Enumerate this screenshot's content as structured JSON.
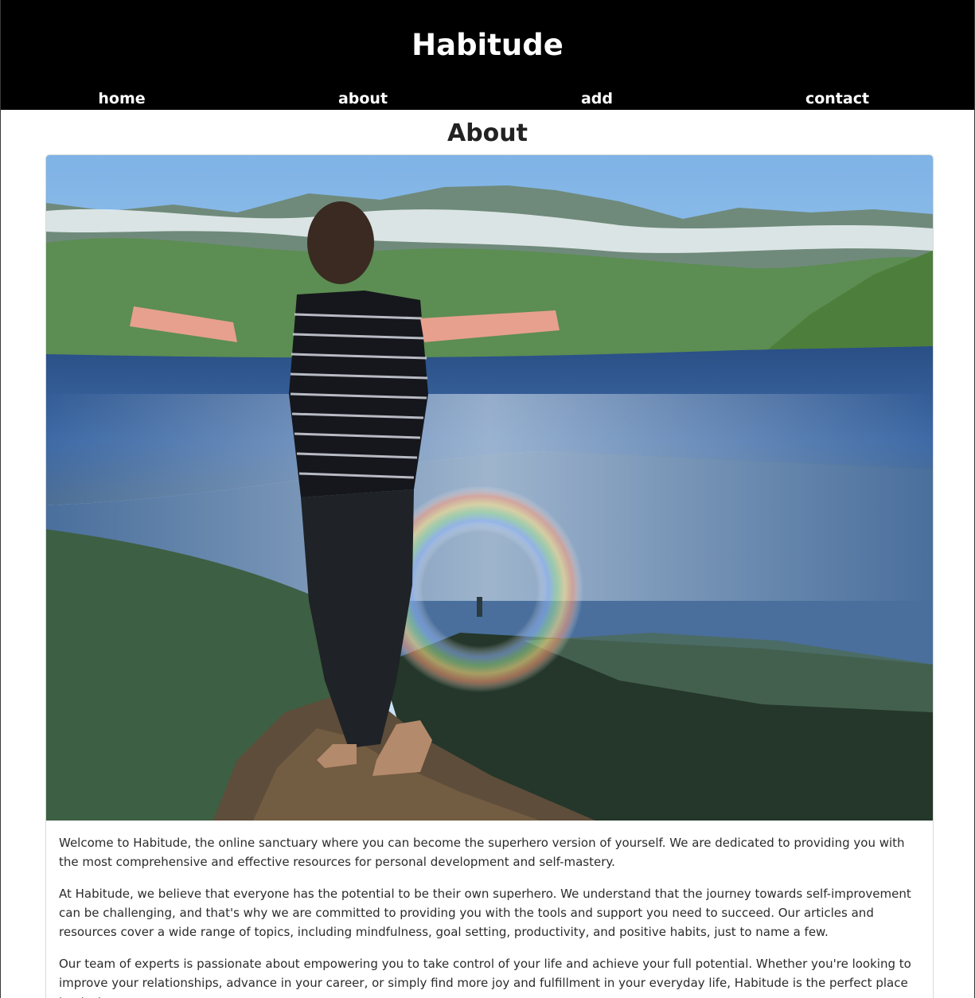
{
  "header": {
    "site_title": "Habitude"
  },
  "nav": {
    "items": [
      {
        "label": "home"
      },
      {
        "label": "about"
      },
      {
        "label": "add"
      },
      {
        "label": "contact"
      }
    ]
  },
  "main": {
    "heading": "About",
    "paragraphs": [
      "Welcome to Habitude, the online sanctuary where you can become the superhero version of yourself. We are dedicated to providing you with the most comprehensive and effective resources for personal development and self-mastery.",
      "At Habitude, we believe that everyone has the potential to be their own superhero. We understand that the journey towards self-improvement can be challenging, and that's why we are committed to providing you with the tools and support you need to succeed. Our articles and resources cover a wide range of topics, including mindfulness, goal setting, productivity, and positive habits, just to name a few.",
      "Our team of experts is passionate about empowering you to take control of your life and achieve your full potential. Whether you're looking to improve your relationships, advance in your career, or simply find more joy and fulfillment in your everyday life, Habitude is the perfect place to start."
    ]
  },
  "colors": {
    "header_bg": "#000000",
    "header_text": "#ffffff",
    "body_text": "#2b2b2b",
    "card_border": "#d9d9d9"
  }
}
